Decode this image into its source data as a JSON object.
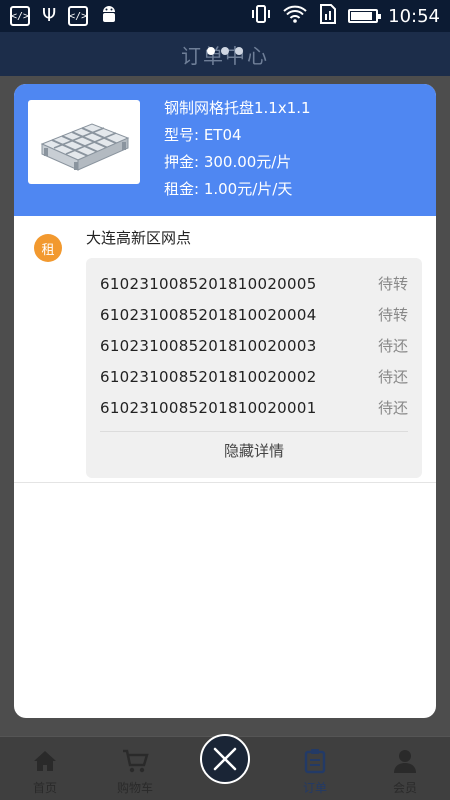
{
  "status_bar": {
    "time": "10:54",
    "left_icons": [
      "code-icon",
      "usb-icon",
      "code-icon",
      "android-icon"
    ],
    "right_icons": [
      "vibrate-icon",
      "wifi-icon",
      "sim-icon",
      "battery-icon"
    ],
    "battery_level": 0.85
  },
  "header": {
    "title": "订单中心"
  },
  "carousel": {
    "total": 3,
    "active": 0
  },
  "product": {
    "name": "钢制网格托盘1.1x1.1",
    "model": "型号: ET04",
    "deposit": "押金: 300.00元/片",
    "rent": "租金: 1.00元/片/天",
    "image_icon": "pallet-icon"
  },
  "rental": {
    "badge": "租",
    "store": "大连高新区网点",
    "items": [
      {
        "serial": "6102310085201810020005",
        "status": "待转"
      },
      {
        "serial": "6102310085201810020004",
        "status": "待转"
      },
      {
        "serial": "6102310085201810020003",
        "status": "待还"
      },
      {
        "serial": "6102310085201810020002",
        "status": "待还"
      },
      {
        "serial": "6102310085201810020001",
        "status": "待还"
      }
    ],
    "hide_label": "隐藏详情"
  },
  "nav": {
    "items": [
      {
        "label": "首页",
        "icon": "home-icon"
      },
      {
        "label": "购物车",
        "icon": "cart-icon"
      },
      {
        "label": "订单",
        "icon": "clipboard-icon"
      },
      {
        "label": "会员",
        "icon": "user-icon"
      }
    ],
    "active_index": 2
  },
  "colors": {
    "accent": "#4f87f2",
    "badge": "#f2992f",
    "status_bar": "#0c1b33"
  }
}
